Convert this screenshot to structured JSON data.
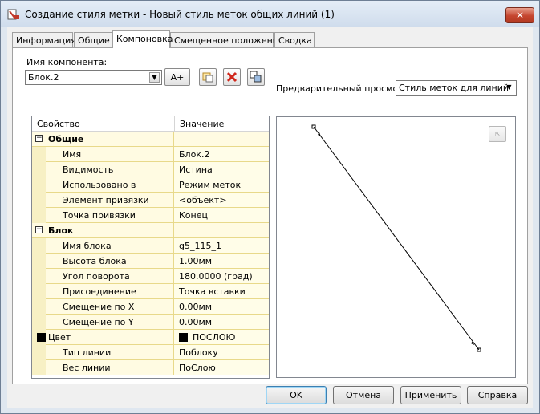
{
  "window": {
    "title": "Создание стиля метки - Новый стиль меток общих линий (1)",
    "close_glyph": "✕"
  },
  "tabs": [
    "Информация",
    "Общие",
    "Компоновка",
    "Смещенное положение",
    "Сводка"
  ],
  "component": {
    "label": "Имя компонента:",
    "value": "Блок.2",
    "add_button_glyph": "A+"
  },
  "grid": {
    "col_property": "Свойство",
    "col_value": "Значение",
    "rows": [
      {
        "type": "category",
        "name": "Общие",
        "value": ""
      },
      {
        "type": "item",
        "name": "Имя",
        "value": "Блок.2"
      },
      {
        "type": "item",
        "name": "Видимость",
        "value": "Истина"
      },
      {
        "type": "item",
        "name": "Использовано в",
        "value": "Режим меток"
      },
      {
        "type": "item",
        "name": "Элемент привязки",
        "value": "<объект>"
      },
      {
        "type": "item",
        "name": "Точка привязки",
        "value": "Конец"
      },
      {
        "type": "category",
        "name": "Блок",
        "value": ""
      },
      {
        "type": "item",
        "name": "Имя блока",
        "value": "g5_115_1"
      },
      {
        "type": "item",
        "name": "Высота блока",
        "value": "1.00мм"
      },
      {
        "type": "item",
        "name": "Угол поворота",
        "value": "180.0000 (град)"
      },
      {
        "type": "item",
        "name": "Присоединение",
        "value": "Точка вставки"
      },
      {
        "type": "item",
        "name": "Смещение по X",
        "value": "0.00мм"
      },
      {
        "type": "item",
        "name": "Смещение по Y",
        "value": "0.00мм"
      },
      {
        "type": "item",
        "name": "Цвет",
        "value": "ПОСЛОЮ",
        "swatch": "#000000"
      },
      {
        "type": "item",
        "name": "Тип линии",
        "value": "Поблоку"
      },
      {
        "type": "item",
        "name": "Вес линии",
        "value": "ПоСлою"
      }
    ]
  },
  "preview": {
    "label": "Предварительный просмотр",
    "mode": "Стиль меток для линий",
    "zoom_button_glyph": "⇱"
  },
  "buttons": {
    "ok": "OK",
    "cancel": "Отмена",
    "apply": "Применить",
    "help": "Справка"
  },
  "colors": {
    "row_bg": "#fffbe2",
    "grid_line": "#e8d98a",
    "close_red": "#c5452e"
  }
}
